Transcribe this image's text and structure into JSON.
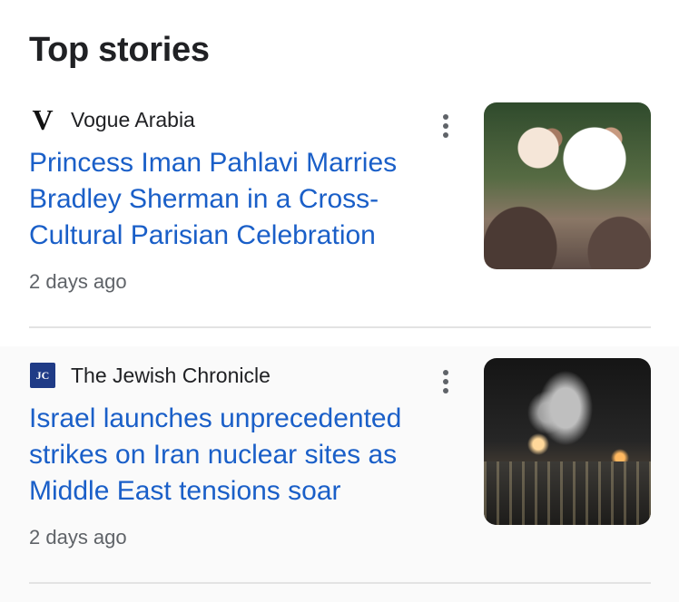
{
  "section": {
    "title": "Top stories"
  },
  "stories": [
    {
      "source": "Vogue Arabia",
      "source_logo": "V",
      "headline": "Princess Iman Pahlavi Marries Bradley Sherman in a Cross-Cultural Parisian Celebration",
      "time": "2 days ago",
      "thumbnail": "wedding-photo"
    },
    {
      "source": "The Jewish Chronicle",
      "source_logo": "JC",
      "headline": "Israel launches unprecedented strikes on Iran nuclear sites as Middle East tensions soar",
      "time": "2 days ago",
      "thumbnail": "night-city-smoke-photo"
    }
  ],
  "icons": {
    "more": "more-vert-icon"
  },
  "colors": {
    "headline": "#1a5fc8",
    "meta": "#5f6368",
    "divider": "#e3e3e3"
  }
}
